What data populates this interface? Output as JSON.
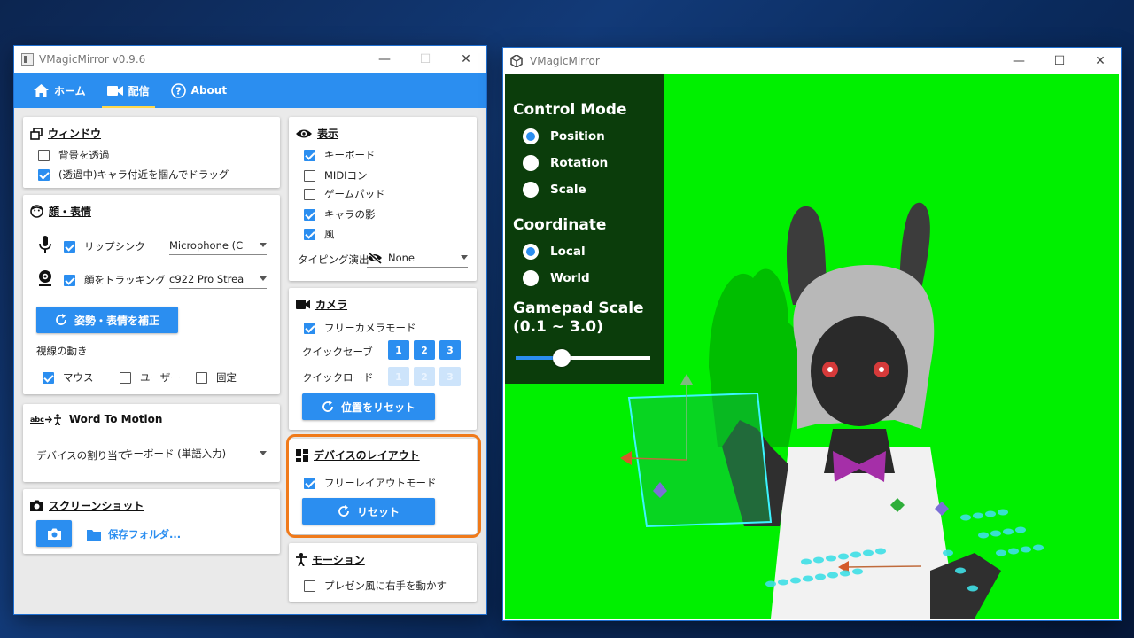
{
  "app": {
    "title": "VMagicMirror v0.9.6",
    "nav": [
      {
        "label": "ホーム",
        "icon": "home-icon",
        "active": false
      },
      {
        "label": "配信",
        "icon": "video-camera-icon",
        "active": true
      },
      {
        "label": "About",
        "icon": "help-icon",
        "active": false
      }
    ],
    "window_card": {
      "title": "ウィンドウ",
      "transparent_bg": {
        "label": "背景を透過",
        "checked": false
      },
      "drag_char": {
        "label": "(透過中)キャラ付近を掴んでドラッグ",
        "checked": true
      }
    },
    "face_card": {
      "title": "顔・表情",
      "lipsync": {
        "label": "リップシンク",
        "checked": true,
        "device": "Microphone (C"
      },
      "face_tracking": {
        "label": "顔をトラッキング",
        "checked": true,
        "device": "c922 Pro Strea"
      },
      "calibrate_button": "姿勢・表情を補正",
      "gaze_label": "視線の動き",
      "gaze_options": [
        {
          "label": "マウス",
          "checked": true
        },
        {
          "label": "ユーザー",
          "checked": false
        },
        {
          "label": "固定",
          "checked": false
        }
      ]
    },
    "word_to_motion": {
      "title": "Word To Motion",
      "title_icon_text": "abc",
      "device_label": "デバイスの割り当て",
      "device_value": "キーボード (単語入力)"
    },
    "screenshot": {
      "title": "スクリーンショット",
      "save_folder": "保存フォルダ..."
    },
    "display_card": {
      "title": "表示",
      "items": [
        {
          "label": "キーボード",
          "checked": true
        },
        {
          "label": "MIDIコン",
          "checked": false
        },
        {
          "label": "ゲームパッド",
          "checked": false
        },
        {
          "label": "キャラの影",
          "checked": true
        },
        {
          "label": "風",
          "checked": true
        }
      ],
      "typing_effect_label": "タイピング演出",
      "typing_effect_value": "None"
    },
    "camera_card": {
      "title": "カメラ",
      "free_camera": {
        "label": "フリーカメラモード",
        "checked": true
      },
      "quick_save_label": "クイックセーブ",
      "quick_load_label": "クイックロード",
      "slots": [
        "1",
        "2",
        "3"
      ],
      "reset_position_button": "位置をリセット"
    },
    "device_layout_card": {
      "title": "デバイスのレイアウト",
      "free_layout": {
        "label": "フリーレイアウトモード",
        "checked": true
      },
      "reset_button": "リセット"
    },
    "motion_card": {
      "title": "モーション",
      "presentation": {
        "label": "プレゼン風に右手を動かす",
        "checked": false
      }
    }
  },
  "viewer": {
    "title": "VMagicMirror",
    "control_mode_heading": "Control Mode",
    "control_modes": [
      {
        "label": "Position",
        "selected": true
      },
      {
        "label": "Rotation",
        "selected": false
      },
      {
        "label": "Scale",
        "selected": false
      }
    ],
    "coordinate_heading": "Coordinate",
    "coordinates": [
      {
        "label": "Local",
        "selected": true
      },
      {
        "label": "World",
        "selected": false
      }
    ],
    "gamepad_scale_heading": "Gamepad Scale",
    "gamepad_scale_range": "(0.1 ~ 3.0)",
    "gamepad_scale_fraction": 0.34
  },
  "colors": {
    "accent": "#2b8ef0",
    "highlight": "#f07a1a",
    "greenscreen": "#00f000"
  }
}
